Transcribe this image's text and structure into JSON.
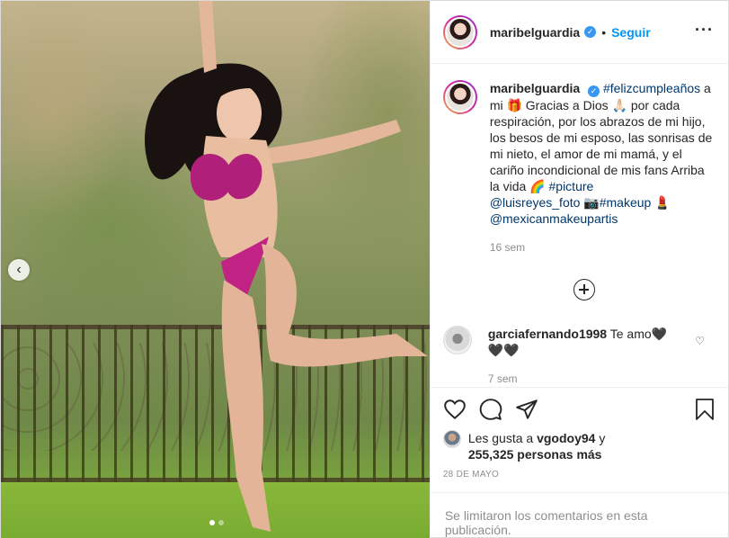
{
  "header": {
    "username": "maribelguardia",
    "separator": "•",
    "follow_label": "Seguir",
    "more_label": "···",
    "verified_mark": "✓"
  },
  "photo": {
    "prev_label": "‹",
    "slides": 2,
    "active_slide": 1
  },
  "caption": {
    "username": "maribelguardia",
    "verified_mark": "✓",
    "hashtag1": "#felizcumpleaños",
    "text1": " a mi 🎁 Gracias a Dios 🙏🏻 por cada respiración, por los abrazos de mi hijo, los besos de mi esposo, las sonrisas de mi nieto, el amor de mi mamá, y el cariño incondicional de mis fans Arriba la vida 🌈 ",
    "hashtag2": "#picture",
    "mention1": "@luisreyes_foto",
    "text2": " 📷",
    "hashtag3": "#makeup",
    "text3": " 💄 ",
    "mention2": "@mexicanmakeupartis",
    "time": "16 sem"
  },
  "comment": {
    "username": "garciafernando1998",
    "text": " Te amo🖤🖤🖤",
    "time": "7 sem",
    "heart": "♡"
  },
  "likes": {
    "prefix": "Les gusta a ",
    "user": "vgodoy94",
    "connector": " y",
    "count": "255,325 personas más"
  },
  "date": "28 DE MAYO",
  "comments_limited": "Se limitaron los comentarios en esta publicación.",
  "colors": {
    "accent": "#0095f6",
    "verified": "#3897f0",
    "muted": "#8e8e8e",
    "text": "#262626"
  }
}
